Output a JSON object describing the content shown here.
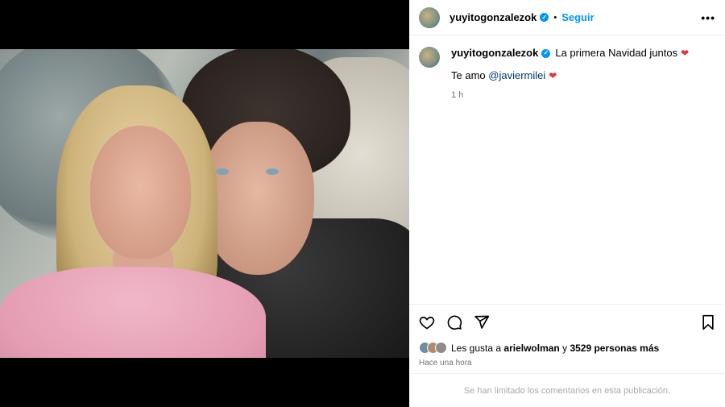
{
  "post": {
    "username": "yuyitogonzalezok",
    "follow_label": "Seguir",
    "more_label": "•••",
    "separator": "•"
  },
  "caption": {
    "username": "yuyitogonzalezok",
    "text": "La primera Navidad juntos",
    "line2_prefix": "Te amo",
    "mention": "@javiermilei",
    "time": "1 h"
  },
  "likes": {
    "prefix": "Les gusta a",
    "user": "ariel​wolman",
    "connector": "y",
    "count_text": "3529 personas más",
    "posted": "Hace una hora"
  },
  "comments": {
    "limited_text": "Se han limitado los comentarios en esta publicación."
  },
  "colors": {
    "accent": "#0095f6",
    "heart": "#ed2f3a",
    "mention": "#00376b",
    "muted": "#737373"
  },
  "icons": {
    "verified": "verified-badge-icon",
    "heart": "heart-icon",
    "like": "heart-outline-icon",
    "comment": "comment-icon",
    "share": "send-icon",
    "save": "bookmark-icon",
    "more": "more-options-icon"
  }
}
